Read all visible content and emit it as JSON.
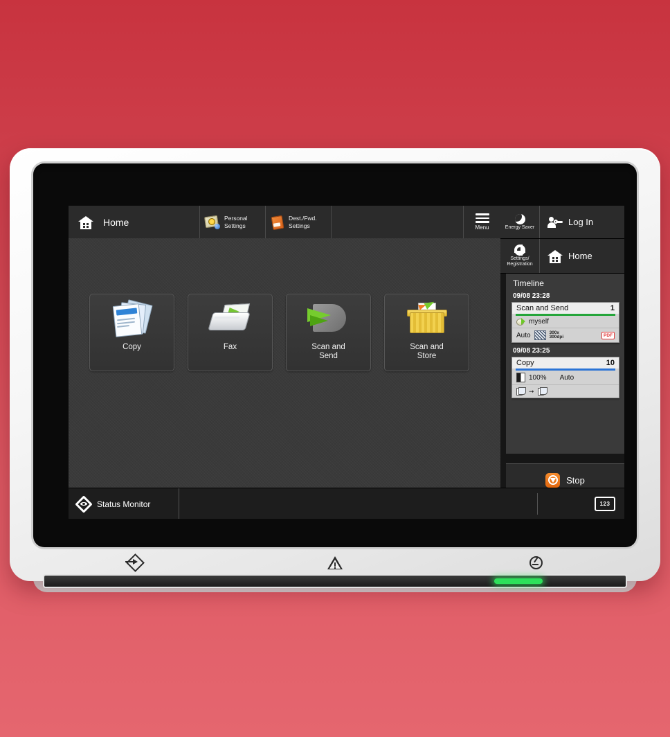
{
  "background": {
    "top_color": "#c8333f",
    "bottom_color": "#e5666f"
  },
  "device": {
    "bezel_color": "#f2f2f2",
    "screen_color": "#0a0a0a"
  },
  "topbar": {
    "home": {
      "label": "Home",
      "icon": "home-icon"
    },
    "buttons": [
      {
        "label_line1": "Personal",
        "label_line2": "Settings",
        "icon": "personal-settings-icon"
      },
      {
        "label_line1": "Dest./Fwd.",
        "label_line2": "Settings",
        "icon": "destination-forward-settings-icon"
      }
    ],
    "menu": {
      "label": "Menu",
      "icon": "hamburger-menu-icon"
    }
  },
  "right_column": {
    "energy_saver": {
      "label": "Energy Saver",
      "icon": "moon-icon"
    },
    "log_in": {
      "label": "Log In",
      "icon": "user-key-icon"
    },
    "settings_registration": {
      "label_line1": "Settings/",
      "label_line2": "Registration",
      "icon": "gear-icon"
    },
    "home": {
      "label": "Home",
      "icon": "home-icon"
    },
    "stop": {
      "label": "Stop",
      "icon": "stop-icon"
    }
  },
  "timeline": {
    "title": "Timeline",
    "entries": [
      {
        "time": "09/08 23:28",
        "job": "Scan and Send",
        "count": "1",
        "accent_color": "#25a53a",
        "destination": "myself",
        "detail_mode": "Auto",
        "detail_dpi_line1": "300x",
        "detail_dpi_line2": "300dpi",
        "format_badge": "PDF"
      },
      {
        "time": "09/08 23:25",
        "job": "Copy",
        "count": "10",
        "accent_color": "#2b74d6",
        "detail_zoom": "100%",
        "detail_paper": "Auto"
      }
    ]
  },
  "main": {
    "tiles": [
      {
        "caption": "Copy",
        "icon": "copy-icon"
      },
      {
        "caption": "Fax",
        "icon": "fax-icon"
      },
      {
        "caption_line1": "Scan and",
        "caption_line2": "Send",
        "icon": "scan-and-send-icon"
      },
      {
        "caption_line1": "Scan and",
        "caption_line2": "Store",
        "icon": "scan-and-store-icon"
      }
    ],
    "pager": {
      "prev_icon": "chevron-left-icon",
      "next_icon": "chevron-right-icon",
      "page_position_percent": 0
    }
  },
  "bottom_bar": {
    "status_monitor": {
      "label": "Status Monitor",
      "icon": "status-monitor-icon"
    },
    "numeric_keys": {
      "label": "123",
      "icon": "numeric-keypad-icon"
    }
  },
  "hardware": {
    "buttons": [
      {
        "icon": "data-in-icon"
      },
      {
        "icon": "error-warning-icon"
      },
      {
        "icon": "power-icon"
      }
    ],
    "led_color": "#2ee05a"
  }
}
